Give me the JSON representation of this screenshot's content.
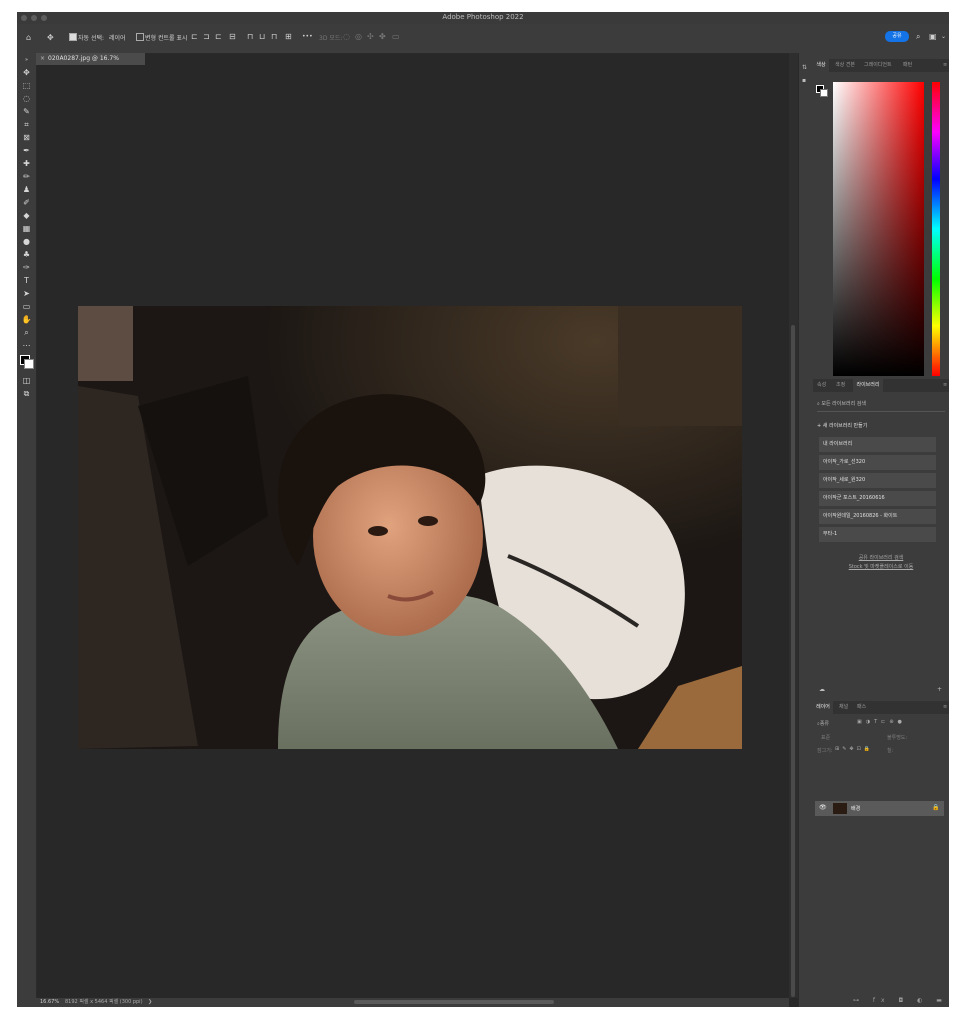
{
  "app": {
    "title": "Adobe Photoshop 2022"
  },
  "options_bar": {
    "auto_select_label": "자동 선택:",
    "auto_select_value": "레이어",
    "transform_label": "변형 컨트롤 표시",
    "more": "•••",
    "mode_3d": "3D 모드:",
    "share_label": "공유"
  },
  "document": {
    "tab_title": "020A0287.jpg @ 16.7% (RGB/8*)",
    "zoom": "16.67%",
    "size_info": "8192 픽셀 x 5464 픽셀 (300 ppi)"
  },
  "color_panel": {
    "tabs": [
      "색상",
      "색상 견본",
      "그레이디언트",
      "패턴"
    ],
    "foreground": "#000000",
    "background": "#ffffff"
  },
  "libraries_panel": {
    "tabs": [
      "속성",
      "조정",
      "라이브러리"
    ],
    "search_placeholder": "모든 라이브러리 검색",
    "new_library": "새 라이브러리 만들기",
    "items": [
      "내 라이브러리",
      "아이작_가로_선320",
      "아이작_세로_원320",
      "아이작군 포스트_20160616",
      "아이작원데일_20160826 - 화이트",
      "무타-1"
    ],
    "link1": "공유 라이브러리 검색",
    "link2": "Stock 및 마켓플레이스로 이동"
  },
  "layers_panel": {
    "tabs": [
      "레이어",
      "채널",
      "패스"
    ],
    "filter_kind": "종류",
    "blend_mode": "표준",
    "opacity_label": "불투명도:",
    "lock_label": "잠그기:",
    "fill_label": "칠:",
    "layer_name": "배경"
  },
  "colors": {
    "accent": "#1473e6",
    "panel": "#3c3c3c",
    "canvas": "#282828"
  }
}
